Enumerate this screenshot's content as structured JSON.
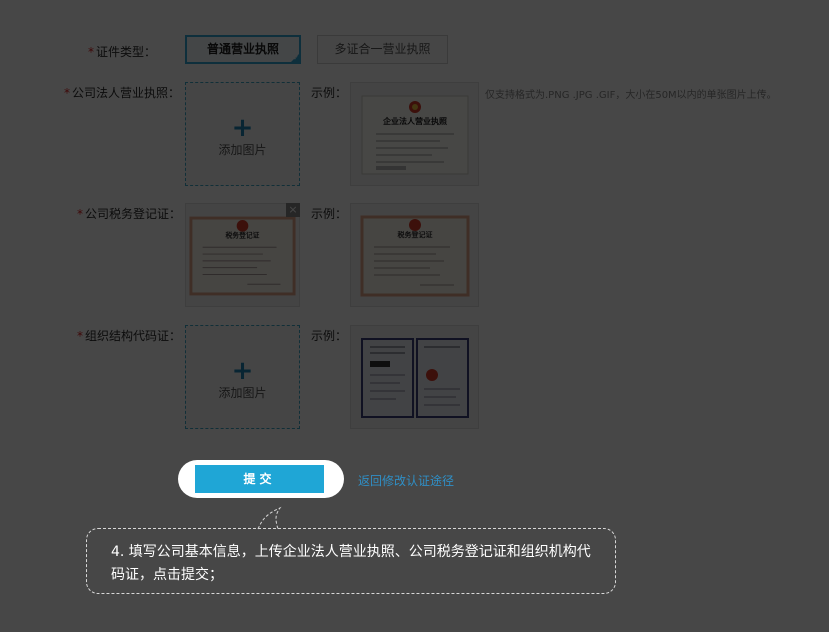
{
  "form": {
    "cert_type": {
      "label": "证件类型：",
      "options": [
        "普通营业执照",
        "多证合一营业执照"
      ],
      "selected_index": 0
    },
    "business_license": {
      "label": "公司法人营业执照：",
      "add_text": "添加图片",
      "example_label": "示例：",
      "hint": "仅支持格式为.PNG .JPG .GIF，大小在50M以内的单张图片上传。",
      "example_title": "企业法人营业执照"
    },
    "tax_registration": {
      "label": "公司税务登记证：",
      "example_label": "示例：",
      "remove_symbol": "×",
      "example_title": "税务登记证"
    },
    "org_code": {
      "label": "组织结构代码证：",
      "add_text": "添加图片",
      "example_label": "示例："
    },
    "required_mark": "*",
    "submit_label": "提交",
    "back_link": "返回修改认证途径"
  },
  "tutorial": {
    "step_text": "4. 填写公司基本信息，上传企业法人营业执照、公司税务登记证和组织机构代码证，点击提交；"
  },
  "colors": {
    "accent": "#1fa6d6",
    "active_border": "#35a8d8",
    "required": "#e02020",
    "overlay": "rgba(0,0,0,0.72)"
  }
}
